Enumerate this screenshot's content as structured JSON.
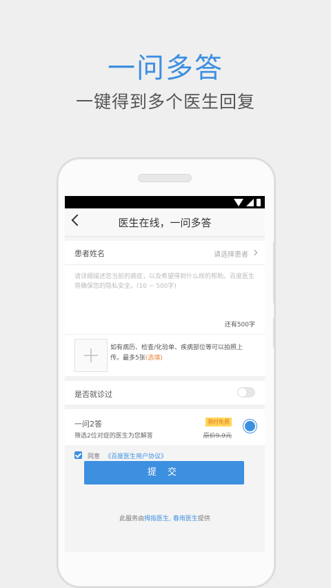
{
  "promo": {
    "title": "一问多答",
    "subtitle": "一键得到多个医生回复"
  },
  "app": {
    "nav_title": "医生在线，一问多答",
    "patient": {
      "label": "患者姓名",
      "placeholder": "请选择患者"
    },
    "description": {
      "placeholder": "请详细描述您当前的病症，以及希望得到什么样的帮助。百度医生将确保您的隐私安全。(10 ~ 500字)",
      "remaining": "还有500字"
    },
    "upload": {
      "text": "如有病历、检查/化验单、疾病部位等可以拍照上传。最多5张",
      "optional": "(选填)"
    },
    "visited": {
      "label": "是否就诊过",
      "value": false
    },
    "plan": {
      "name": "一问2答",
      "description": "筛选2位对症的医生为您解答",
      "badge": "限时免费",
      "original_price": "原价9.9元",
      "selected": true
    },
    "agreement": {
      "checked": true,
      "label": "同意",
      "link": "《百度医生用户协议》"
    },
    "submit_label": "提 交",
    "footer": {
      "prefix": "此服务由",
      "provider1": "拇指医生",
      "sep": ",",
      "provider2": "春雨医生",
      "suffix": "提供"
    }
  },
  "colors": {
    "accent": "#3d8fe0",
    "badge_bg": "#ffd659",
    "optional": "#e8833a"
  }
}
